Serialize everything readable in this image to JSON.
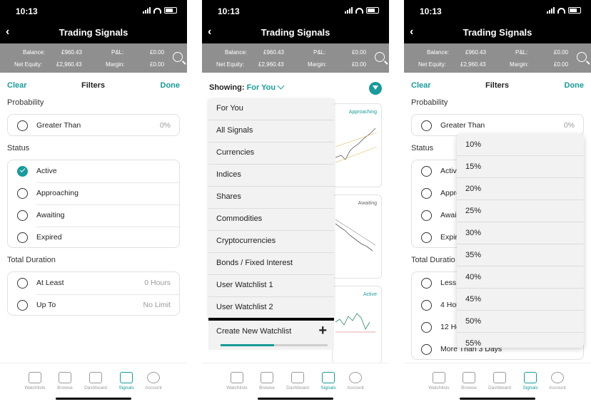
{
  "status": {
    "time": "10:13"
  },
  "header": {
    "title": "Trading Signals",
    "back_icon": "chevron-left-icon"
  },
  "account": {
    "balance_label": "Balance:",
    "balance": "£960.43",
    "pl_label": "P&L:",
    "pl": "£0.00",
    "equity_label": "Net Equity:",
    "equity": "£2,960.43",
    "margin_label": "Margin:",
    "margin": "£0.00"
  },
  "filters": {
    "clear": "Clear",
    "title": "Filters",
    "done": "Done",
    "probability": {
      "title": "Probability",
      "label": "Greater Than",
      "value": "0%"
    },
    "status": {
      "title": "Status",
      "items": [
        "Active",
        "Approaching",
        "Awaiting",
        "Expired"
      ],
      "selected": "Active"
    },
    "duration": {
      "title": "Total Duration",
      "items": [
        {
          "label": "At Least",
          "value": "0 Hours"
        },
        {
          "label": "Up To",
          "value": "No Limit"
        }
      ]
    }
  },
  "signals": {
    "showing_label": "Showing:",
    "showing_value": "For You",
    "menu": [
      "For You",
      "All Signals",
      "Currencies",
      "Indices",
      "Shares",
      "Commodities",
      "Cryptocurrencies",
      "Bonds / Fixed Interest",
      "User Watchlist 1",
      "User Watchlist 2"
    ],
    "create": "Create New Watchlist",
    "create_progress": 0.5,
    "cards": [
      {
        "status": "Approaching"
      },
      {
        "status": "Awaiting"
      },
      {
        "status": "Active"
      }
    ]
  },
  "picker": {
    "options": [
      "10%",
      "15%",
      "20%",
      "25%",
      "30%",
      "35%",
      "40%",
      "45%",
      "50%",
      "55%"
    ],
    "duration_partial": [
      "Less",
      "4 Hou",
      "12 Ho"
    ],
    "status_partial": [
      "Active",
      "Appro",
      "Awai",
      "Expir"
    ],
    "duration_title_partial": "Total Duratio",
    "more": "More Than 3 Days"
  },
  "tabs": [
    "Watchlists",
    "Browse",
    "Dashboard",
    "Signals",
    "Account"
  ],
  "active_tab": "Signals",
  "colors": {
    "accent": "#1a9a9a",
    "header": "#000000",
    "account_bar": "#8f8f8f"
  }
}
